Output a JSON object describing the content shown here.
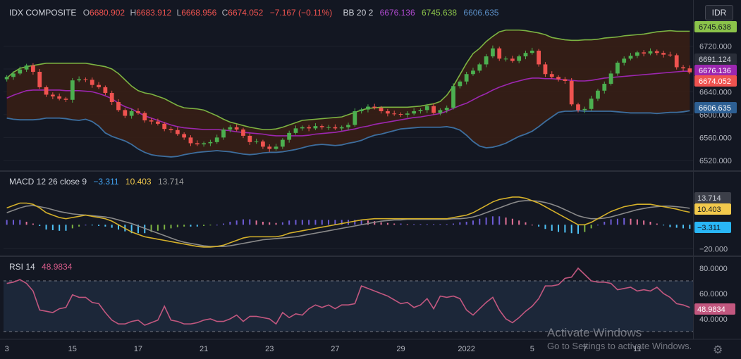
{
  "header": {
    "symbol": "IDX COMPOSITE",
    "o_label": "O",
    "o_value": "6680.902",
    "h_label": "H",
    "h_value": "6683.912",
    "l_label": "L",
    "l_value": "6668.956",
    "c_label": "C",
    "c_value": "6674.052",
    "change": "−7.167 (−0.11%)",
    "bb_label": "BB 20 2",
    "bb_basis": "6676.136",
    "bb_upper": "6745.638",
    "bb_lower": "6606.635"
  },
  "currency_button": "IDR",
  "macd_header": {
    "label": "MACD 12 26 close 9",
    "hist": "−3.311",
    "macd": "10.403",
    "signal": "13.714"
  },
  "rsi_header": {
    "label": "RSI 14",
    "value": "48.9834"
  },
  "watermark": {
    "line1": "Activate Windows",
    "line2": "Go to Settings to activate Windows."
  },
  "colors": {
    "background": "#131722",
    "up": "#26a69a",
    "up_candle": "#4caf50",
    "down": "#ef5350",
    "bb_upper": "#7cb342",
    "bb_lower": "#3d6e9e",
    "bb_basis": "#9c27b0",
    "macd_line": "#d4b02a",
    "signal_line": "#8a8a8a",
    "rsi": "#c2577f"
  },
  "chart_data": [
    {
      "type": "candlestick",
      "title": "IDX COMPOSITE",
      "x_tick_labels": [
        "3",
        "15",
        "17",
        "21",
        "23",
        "27",
        "29",
        "2022",
        "5",
        "7",
        "11"
      ],
      "y_tick_labels": [
        "6720.000",
        "6680.000",
        "6640.000",
        "6600.000",
        "6560.000",
        "6520.000"
      ],
      "ylim": [
        6505,
        6760
      ],
      "price_labels": [
        {
          "name": "BB upper",
          "value": 6745.638
        },
        {
          "name": "last high marker",
          "value": 6691.124
        },
        {
          "name": "BB basis",
          "value": 6676.136
        },
        {
          "name": "close",
          "value": 6674.052
        },
        {
          "name": "BB lower",
          "value": 6606.635
        }
      ],
      "close": [
        6666,
        6672,
        6679,
        6686,
        6675,
        6648,
        6635,
        6632,
        6628,
        6626,
        6660,
        6662,
        6661,
        6652,
        6648,
        6638,
        6622,
        6608,
        6598,
        6606,
        6603,
        6590,
        6588,
        6584,
        6575,
        6573,
        6566,
        6560,
        6550,
        6548,
        6550,
        6552,
        6560,
        6574,
        6578,
        6574,
        6563,
        6552,
        6553,
        6544,
        6540,
        6544,
        6556,
        6568,
        6576,
        6578,
        6576,
        6580,
        6578,
        6578,
        6576,
        6578,
        6582,
        6606,
        6609,
        6614,
        6612,
        6606,
        6602,
        6601,
        6600,
        6602,
        6606,
        6608,
        6615,
        6603,
        6608,
        6612,
        6650,
        6658,
        6671,
        6677,
        6688,
        6702,
        6716,
        6698,
        6698,
        6694,
        6702,
        6708,
        6712,
        6688,
        6671,
        6666,
        6662,
        6659,
        6618,
        6608,
        6610,
        6628,
        6642,
        6654,
        6672,
        6691,
        6698,
        6703,
        6709,
        6707,
        6711,
        6708,
        6705,
        6704,
        6683,
        6681,
        6674
      ],
      "bb_upper": [
        6664,
        6674,
        6681,
        6684,
        6686,
        6688,
        6690,
        6690,
        6690,
        6690,
        6690,
        6690,
        6690,
        6688,
        6686,
        6684,
        6680,
        6672,
        6661,
        6650,
        6642,
        6638,
        6636,
        6632,
        6628,
        6622,
        6616,
        6612,
        6611,
        6610,
        6608,
        6603,
        6598,
        6592,
        6587,
        6584,
        6581,
        6578,
        6576,
        6574,
        6574,
        6575,
        6578,
        6582,
        6586,
        6590,
        6591,
        6592,
        6593,
        6594,
        6595,
        6596,
        6600,
        6604,
        6608,
        6611,
        6612,
        6613,
        6613,
        6613,
        6613,
        6613,
        6614,
        6615,
        6617,
        6619,
        6623,
        6634,
        6650,
        6670,
        6690,
        6707,
        6716,
        6728,
        6737,
        6745,
        6748,
        6748,
        6748,
        6747,
        6745,
        6743,
        6740,
        6735,
        6733,
        6731,
        6730,
        6730,
        6731,
        6731,
        6732,
        6734,
        6735,
        6736,
        6738,
        6739,
        6740,
        6741,
        6743,
        6745,
        6746,
        6747,
        6746,
        6746,
        6746
      ],
      "bb_basis": [
        6629,
        6634,
        6638,
        6642,
        6643,
        6643,
        6643,
        6643,
        6643,
        6642,
        6642,
        6642,
        6641,
        6640,
        6637,
        6633,
        6628,
        6620,
        6614,
        6610,
        6604,
        6598,
        6594,
        6590,
        6586,
        6582,
        6579,
        6577,
        6576,
        6575,
        6574,
        6574,
        6574,
        6573,
        6572,
        6570,
        6569,
        6568,
        6567,
        6566,
        6564,
        6563,
        6563,
        6563,
        6563,
        6563,
        6564,
        6566,
        6567,
        6568,
        6569,
        6571,
        6573,
        6575,
        6578,
        6580,
        6583,
        6585,
        6587,
        6589,
        6591,
        6593,
        6595,
        6596,
        6598,
        6600,
        6602,
        6606,
        6611,
        6616,
        6620,
        6626,
        6632,
        6637,
        6643,
        6648,
        6652,
        6656,
        6659,
        6662,
        6664,
        6664,
        6663,
        6663,
        6662,
        6661,
        6660,
        6659,
        6659,
        6660,
        6662,
        6664,
        6665,
        6666,
        6667,
        6668,
        6669,
        6670,
        6671,
        6672,
        6673,
        6674,
        6675,
        6676,
        6676
      ],
      "bb_lower": [
        6594,
        6592,
        6591,
        6591,
        6591,
        6592,
        6594,
        6594,
        6594,
        6593,
        6591,
        6590,
        6592,
        6588,
        6580,
        6568,
        6562,
        6558,
        6554,
        6548,
        6540,
        6534,
        6530,
        6528,
        6527,
        6526,
        6527,
        6530,
        6532,
        6534,
        6535,
        6536,
        6537,
        6536,
        6535,
        6533,
        6531,
        6530,
        6531,
        6533,
        6534,
        6534,
        6535,
        6537,
        6539,
        6542,
        6545,
        6547,
        6548,
        6547,
        6546,
        6547,
        6550,
        6552,
        6555,
        6560,
        6564,
        6566,
        6569,
        6572,
        6575,
        6576,
        6577,
        6578,
        6578,
        6578,
        6578,
        6579,
        6577,
        6573,
        6564,
        6553,
        6545,
        6542,
        6543,
        6546,
        6550,
        6556,
        6562,
        6566,
        6571,
        6579,
        6588,
        6596,
        6604,
        6606,
        6606,
        6607,
        6606,
        6606,
        6606,
        6606,
        6606,
        6605,
        6604,
        6603,
        6603,
        6603,
        6603,
        6602,
        6603,
        6604,
        6604,
        6605,
        6607
      ]
    },
    {
      "type": "line+histogram",
      "title": "MACD 12 26 close 9",
      "y_tick_labels": [
        "0.000",
        "−20.000"
      ],
      "ylim": [
        -25,
        30
      ],
      "last_values": {
        "macd": 10.403,
        "signal": 13.714,
        "histogram": -3.311
      },
      "macd": [
        14,
        16,
        18,
        18,
        17,
        14,
        10,
        8,
        6,
        5,
        6,
        7,
        8,
        7,
        6,
        5,
        3,
        0,
        -3,
        -6,
        -8,
        -10,
        -11,
        -12,
        -13,
        -14,
        -15,
        -16,
        -17,
        -18,
        -18.5,
        -18.5,
        -18,
        -17,
        -15,
        -13,
        -11,
        -10,
        -10,
        -10,
        -10,
        -10,
        -9,
        -7,
        -6,
        -5,
        -4,
        -3,
        -2,
        -1,
        0,
        1,
        2,
        3,
        4,
        4.5,
        5,
        5,
        5,
        5,
        5,
        5,
        5,
        5,
        5,
        5,
        5,
        5,
        6,
        7,
        8,
        10,
        13,
        16,
        19,
        21,
        22,
        23,
        23,
        22,
        20,
        18,
        15,
        12,
        9,
        6,
        3,
        0,
        0,
        2,
        5,
        8,
        11,
        13,
        15,
        16,
        17,
        17,
        17,
        16,
        15,
        14,
        13,
        11.5,
        10.4
      ],
      "signal": [
        10,
        12,
        14,
        15.5,
        16,
        15,
        14,
        12.5,
        11,
        10,
        9,
        8.5,
        8,
        7.5,
        7,
        6.5,
        5.5,
        4,
        2.5,
        1,
        -1,
        -3,
        -5,
        -7,
        -9,
        -11,
        -13,
        -14.5,
        -15.5,
        -16.5,
        -17.5,
        -18,
        -18,
        -18,
        -17.5,
        -16.5,
        -15.5,
        -14.5,
        -13.5,
        -12.5,
        -12,
        -11.5,
        -11,
        -10.5,
        -10,
        -9,
        -8,
        -7,
        -6,
        -5,
        -4,
        -3,
        -2,
        -1,
        0,
        1,
        2,
        3,
        3.5,
        4,
        4,
        4.5,
        4.5,
        4.5,
        4.5,
        4.5,
        4.5,
        4.5,
        5,
        5,
        5.5,
        6.5,
        8,
        10,
        12,
        14,
        16,
        18,
        19.5,
        20,
        20,
        19.5,
        18.5,
        17,
        15,
        12.5,
        10,
        7.5,
        6,
        5,
        5,
        5.5,
        6.5,
        8,
        9.5,
        11,
        12.5,
        13.5,
        14.5,
        15,
        15.5,
        15.5,
        15,
        14.5,
        13.7
      ],
      "histogram": [
        4,
        4,
        4,
        2.5,
        1,
        -1,
        -4,
        -4.5,
        -5,
        -5,
        -3,
        -1.5,
        0,
        -0.5,
        -1,
        -1.5,
        -2.5,
        -4,
        -5.5,
        -7,
        -7,
        -7,
        -6,
        -5,
        -4,
        -3,
        -2,
        -1.5,
        -1.5,
        -1.5,
        -1,
        -0.5,
        0,
        1,
        2.5,
        3.5,
        4.5,
        4.5,
        3.5,
        2.5,
        2,
        1.5,
        2,
        3.5,
        4,
        4,
        4,
        4,
        4,
        4,
        4,
        4,
        4,
        4,
        4,
        3.5,
        3,
        2,
        1.5,
        1,
        1,
        0.5,
        0.5,
        0.5,
        0.5,
        0.5,
        0.5,
        0.5,
        1,
        2,
        2.5,
        3.5,
        5,
        6,
        7,
        7,
        6,
        5,
        3.5,
        2,
        0,
        -1.5,
        -3.5,
        -5,
        -6,
        -6.5,
        -7,
        -7.5,
        -6,
        -3,
        0,
        2.5,
        4.5,
        5,
        5.5,
        5,
        4.5,
        3.5,
        2.5,
        1,
        -0.5,
        -2,
        -2.5,
        -3,
        -3.3
      ]
    },
    {
      "type": "line",
      "title": "RSI 14",
      "y_tick_labels": [
        "80.0000",
        "60.0000",
        "40.0000"
      ],
      "ylim": [
        25,
        85
      ],
      "band": [
        30,
        70
      ],
      "last_value": 48.9834,
      "values": [
        68,
        69,
        71,
        68,
        62,
        47,
        46,
        45,
        48,
        49,
        59,
        57,
        57,
        53,
        52,
        45,
        39,
        36,
        36,
        38,
        39,
        35,
        37,
        39,
        50,
        39,
        38,
        36,
        36,
        37,
        39,
        40,
        38,
        38,
        40,
        43,
        38,
        42,
        42,
        41,
        40,
        36,
        45,
        41,
        44,
        43,
        48,
        51,
        49,
        51,
        48,
        51,
        51,
        52,
        66,
        64,
        62,
        60,
        58,
        55,
        52,
        53,
        49,
        51,
        56,
        48,
        58,
        57,
        58,
        56,
        47,
        43,
        48,
        53,
        57,
        47,
        40,
        37,
        41,
        46,
        50,
        56,
        66,
        66,
        67,
        72,
        73,
        80,
        75,
        70,
        69,
        69,
        68,
        67,
        57,
        55,
        53,
        47,
        40,
        36,
        39,
        47,
        51,
        55,
        62
      ],
      "rsi_tail": [
        63,
        64,
        65,
        62,
        63,
        62,
        65,
        60,
        57,
        52,
        51,
        49
      ]
    }
  ]
}
